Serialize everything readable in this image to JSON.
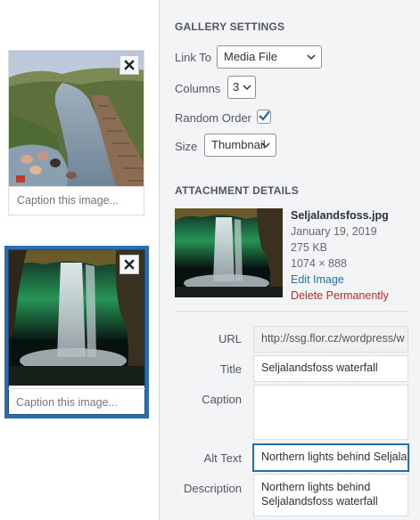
{
  "gallery": {
    "items": [
      {
        "caption_placeholder": "Caption this image...",
        "selected": false
      },
      {
        "caption_placeholder": "Caption this image...",
        "selected": true
      }
    ]
  },
  "gallery_settings": {
    "heading": "GALLERY SETTINGS",
    "link_to_label": "Link To",
    "link_to_value": "Media File",
    "columns_label": "Columns",
    "columns_value": "3",
    "random_order_label": "Random Order",
    "random_order_checked": true,
    "size_label": "Size",
    "size_value": "Thumbnail"
  },
  "attachment": {
    "heading": "ATTACHMENT DETAILS",
    "filename": "Seljalandsfoss.jpg",
    "date": "January 19, 2019",
    "filesize": "275 KB",
    "dimensions": "1074 × 888",
    "edit_link": "Edit Image",
    "delete_link": "Delete Permanently",
    "url_label": "URL",
    "url_value": "http://ssg.flor.cz/wordpress/w",
    "title_label": "Title",
    "title_value": "Seljalandsfoss waterfall",
    "caption_label": "Caption",
    "caption_value": "",
    "alt_label": "Alt Text",
    "alt_value": "Northern lights behind Seljala",
    "description_label": "Description",
    "description_value": "Northern lights behind Seljalandsfoss waterfall"
  },
  "colors": {
    "accent": "#2271b1",
    "selected_border": "#2a6eb0",
    "delete": "#b32d2e",
    "panel_bg": "#f3f4f5"
  }
}
